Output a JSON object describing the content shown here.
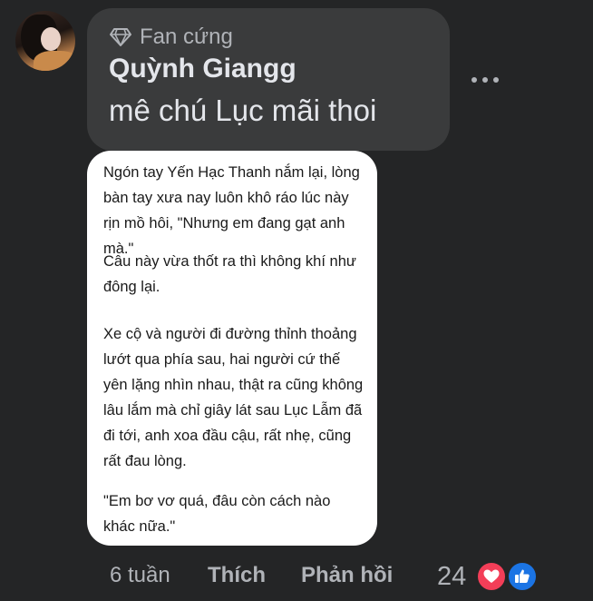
{
  "comment": {
    "badge_label": "Fan cứng",
    "badge_icon": "diamond-icon",
    "author": "Quỳnh Giangg",
    "text": "mê chú Lục mãi thoi",
    "more_icon": "more-options-icon"
  },
  "attachment": {
    "paragraphs": [
      "Ngón tay Yến Hạc Thanh nắm lại, lòng bàn tay xưa nay luôn khô ráo lúc này rịn mồ hôi, \"Nhưng em đang gạt anh mà.\"",
      "Câu này vừa thốt ra thì không khí như đông lại.",
      "Xe cộ và người đi đường thỉnh thoảng lướt qua phía sau, hai người cứ thế yên lặng nhìn nhau, thật ra cũng không lâu lắm mà chỉ giây lát sau Lục Lẫm đã đi tới, anh xoa đầu cậu, rất nhẹ, cũng rất đau lòng.",
      "\"Em bơ vơ quá, đâu còn cách nào khác nữa.\""
    ]
  },
  "actions": {
    "time": "6 tuần",
    "like_label": "Thích",
    "reply_label": "Phản hồi",
    "reaction_count": "24",
    "reactions": [
      "heart-icon",
      "thumbs-up-icon"
    ]
  },
  "colors": {
    "background": "#242526",
    "bubble": "#3a3b3c",
    "primary_text": "#e4e6eb",
    "secondary_text": "#b0b3b8",
    "heart": "#f33e58",
    "like": "#1b74e4"
  }
}
